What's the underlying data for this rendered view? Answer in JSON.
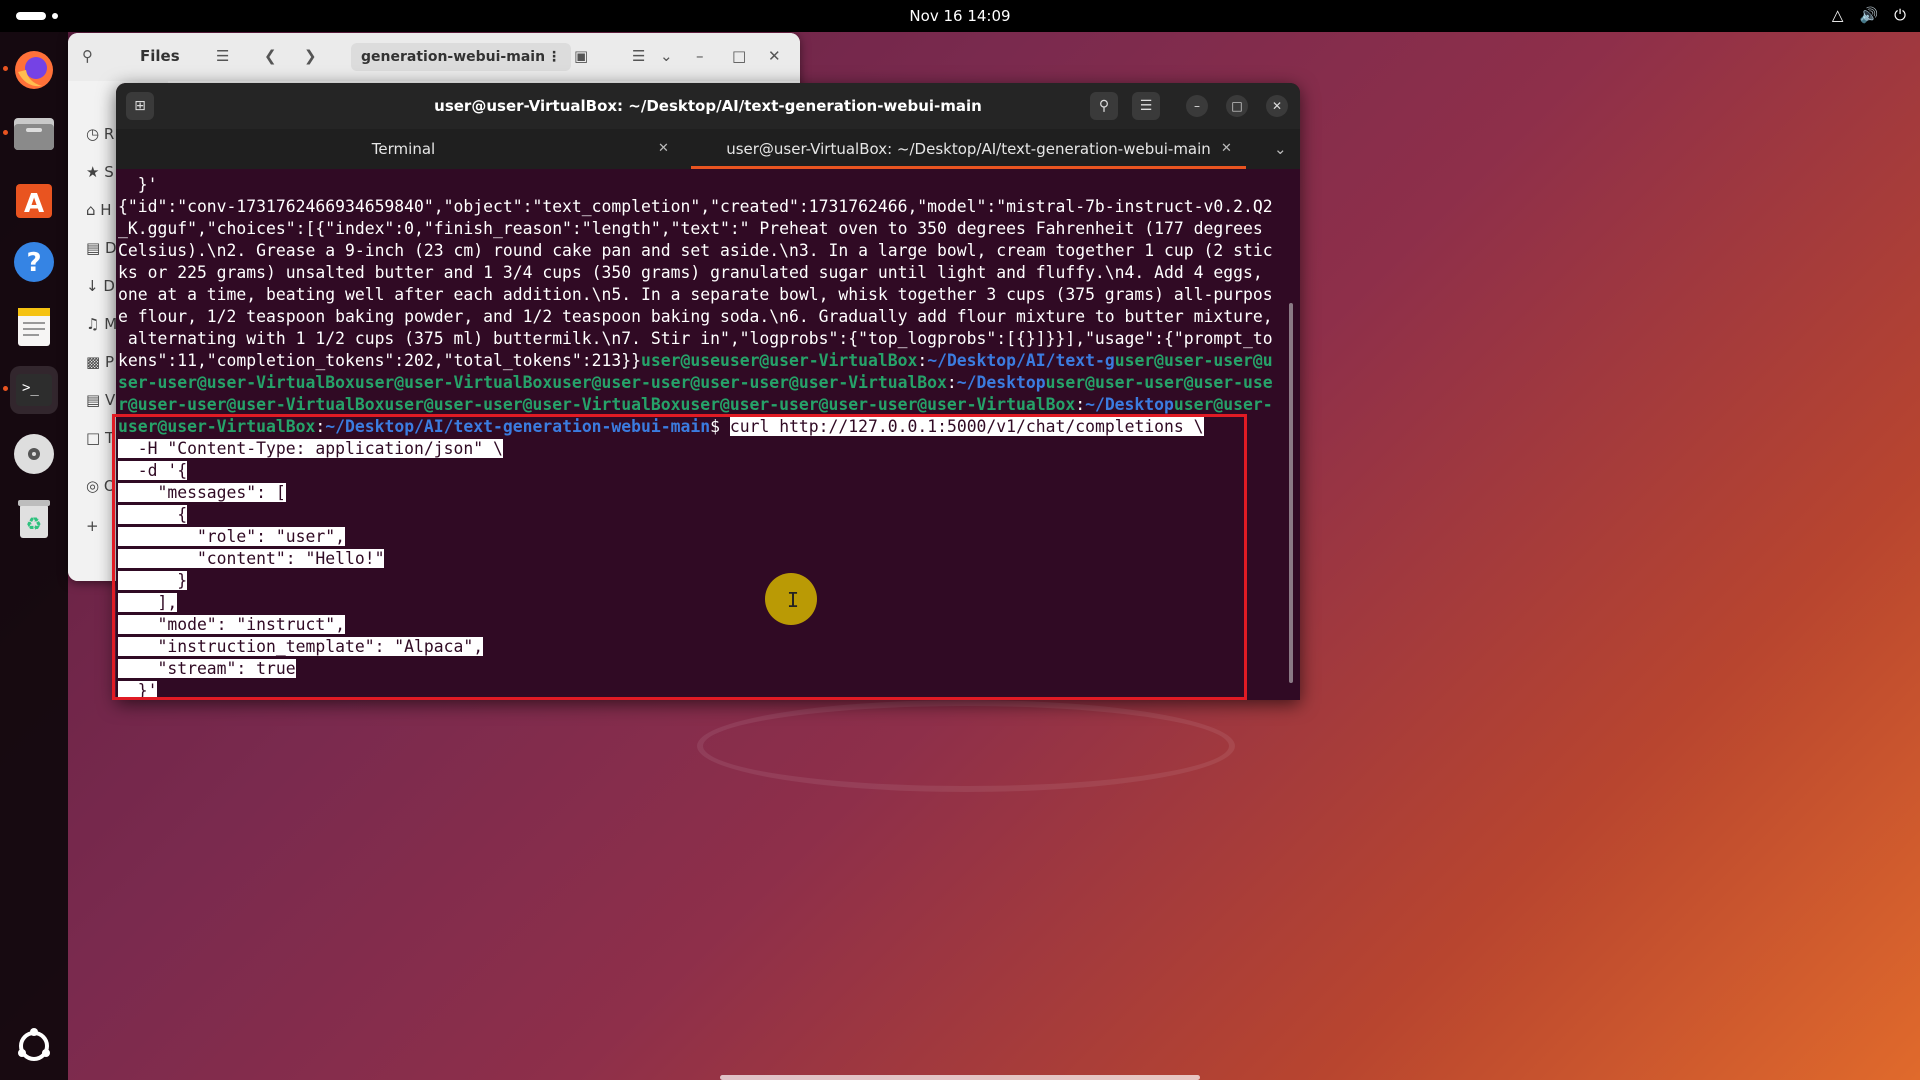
{
  "topbar": {
    "clock": "Nov 16  14:09"
  },
  "files": {
    "title": "Files",
    "path": "generation-webui-main",
    "sidebar_letters": [
      "R",
      "S",
      "H",
      "D",
      "D",
      "M",
      "P",
      "V",
      "T",
      "O",
      "+"
    ]
  },
  "terminal": {
    "title": "user@user-VirtualBox: ~/Desktop/AI/text-generation-webui-main",
    "tabs": [
      {
        "label": "Terminal"
      },
      {
        "label": "user@user-VirtualBox: ~/Desktop/AI/text-generation-webui-main"
      }
    ],
    "lines": [
      "  }'",
      "{\"id\":\"conv-1731762466934659840\",\"object\":\"text_completion\",\"created\":1731762466,\"model\":\"mistral-7b-instruct-v0.2.Q2",
      "_K.gguf\",\"choices\":[{\"index\":0,\"finish_reason\":\"length\",\"text\":\" Preheat oven to 350 degrees Fahrenheit (177 degrees",
      "Celsius).\\n2. Grease a 9-inch (23 cm) round cake pan and set aside.\\n3. In a large bowl, cream together 1 cup (2 stic",
      "ks or 225 grams) unsalted butter and 1 3/4 cups (350 grams) granulated sugar until light and fluffy.\\n4. Add 4 eggs,",
      "one at a time, beating well after each addition.\\n5. In a separate bowl, whisk together 3 cups (375 grams) all-purpos",
      "e flour, 1/2 teaspoon baking powder, and 1/2 teaspoon baking soda.\\n6. Gradually add flour mixture to butter mixture,",
      " alternating with 1 1/2 cups (375 ml) buttermilk.\\n7. Stir in\",\"logprobs\":{\"top_logprobs\":[{}]}}],\"usage\":{\"prompt_to",
      "kens\":11,\"completion_tokens\":202,\"total_tokens\":213}}"
    ],
    "prompt_line1_tail": {
      "green": "user@useuser@user-VirtualBox",
      "colon": ":",
      "blue": "~/Desktop/AI/text-g",
      "green2": "user@user-user@u"
    },
    "prompt_line2": {
      "green": "ser-user@user-VirtualBoxuser@user-VirtualBoxuser@user-user@user-user@user-VirtualBox",
      "colon": ":",
      "blue": "~/Desktop",
      "green2": "user@user-user@user-use"
    },
    "prompt_line3": {
      "green": "r@user-user@user-VirtualBoxuser@user-user@user-VirtualBoxuser@user-user@user-user@user-VirtualBox",
      "colon": ":",
      "blue": "~/Desktop",
      "green2": "user@user-"
    },
    "prompt_line4": {
      "green": "user@user-VirtualBox",
      "colon": ":",
      "blue": "~/Desktop/AI/text-generation-webui-main",
      "dollar": "$ ",
      "cmd": "curl http://127.0.0.1:5000/v1/chat/completions \\"
    },
    "selected_lines": [
      "  -H \"Content-Type: application/json\" \\",
      "  -d '{",
      "    \"messages\": [",
      "      {",
      "        \"role\": \"user\",",
      "        \"content\": \"Hello!\"",
      "      }",
      "    ],",
      "    \"mode\": \"instruct\",",
      "    \"instruction_template\": \"Alpaca\",",
      "    \"stream\": true",
      "  }'"
    ]
  }
}
